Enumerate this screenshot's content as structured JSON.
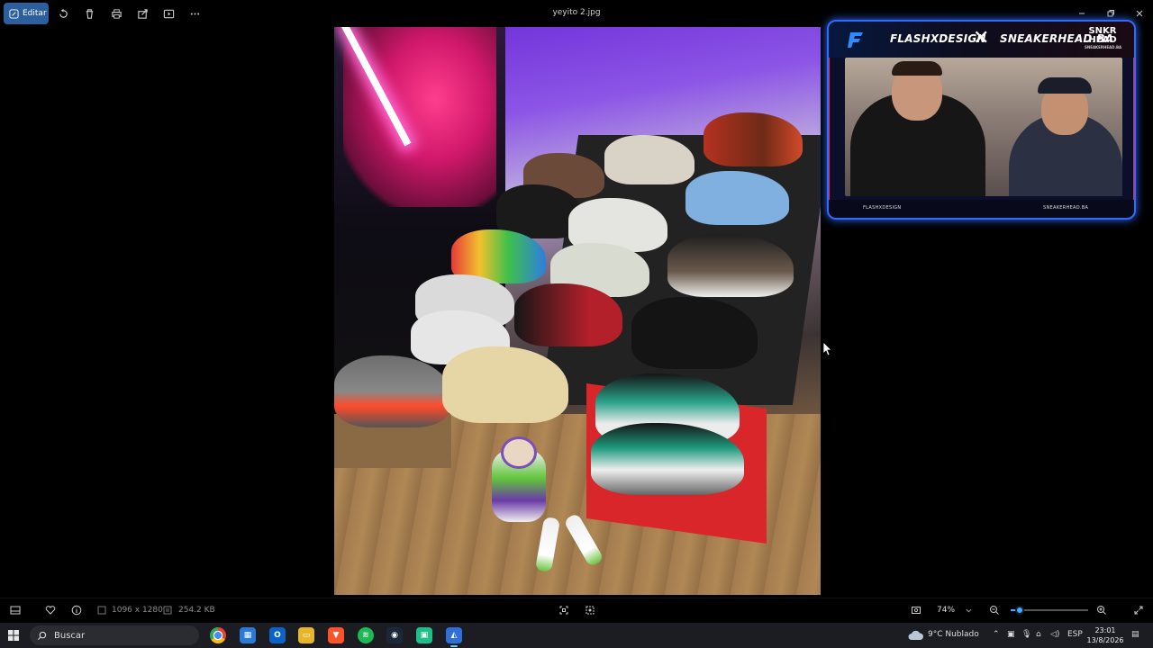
{
  "window": {
    "title": "yeyito 2.jpg",
    "edit_label": "Editar"
  },
  "webcam": {
    "brand_left": "FLASHXDESIGN",
    "brand_right": "SNEAKERHEAD.BA",
    "snkr_line1": "SNKR",
    "snkr_line2": "HEAD",
    "snkr_sub": "SNEAKERHEAD.BA",
    "handle_left": "FLASHXDESIGN",
    "handle_right": "SNEAKERHEAD.BA"
  },
  "status": {
    "dimensions": "1096 x 1280",
    "file_size": "254.2 KB",
    "zoom": "74%",
    "zoom_fraction": 0.12
  },
  "taskbar": {
    "search_label": "Buscar",
    "weather": "9°C  Nublado",
    "language": "ESP",
    "time": "23:01",
    "date": "13/8/2026"
  }
}
